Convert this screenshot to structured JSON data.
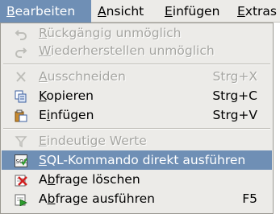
{
  "menubar": {
    "items": [
      {
        "label": "Bearbeiten",
        "mnemonic_index": 0
      },
      {
        "label": "Ansicht",
        "mnemonic_index": 0
      },
      {
        "label": "Einfügen",
        "mnemonic_index": 0
      },
      {
        "label": "Extras",
        "mnemonic_index": 0
      }
    ]
  },
  "menu": {
    "items": [
      {
        "label": "Rückgängig unmöglich",
        "shortcut": "",
        "enabled": false,
        "icon": "undo-icon"
      },
      {
        "label": "Wiederherstellen unmöglich",
        "shortcut": "",
        "enabled": false,
        "icon": "redo-icon"
      },
      {
        "label": "Ausschneiden",
        "shortcut": "Strg+X",
        "enabled": false,
        "icon": "cut-icon"
      },
      {
        "label": "Kopieren",
        "shortcut": "Strg+C",
        "enabled": true,
        "icon": "copy-icon"
      },
      {
        "label": "Einfügen",
        "shortcut": "Strg+V",
        "enabled": true,
        "icon": "paste-icon"
      },
      {
        "label": "Eindeutige Werte",
        "shortcut": "",
        "enabled": false,
        "icon": "distinct-values-icon"
      },
      {
        "label": "SQL-Kommando direkt ausführen",
        "shortcut": "",
        "enabled": true,
        "selected": true,
        "icon": "sql-icon"
      },
      {
        "label": "Abfrage löschen",
        "shortcut": "",
        "enabled": true,
        "icon": "clear-query-icon"
      },
      {
        "label": "Abfrage ausführen",
        "shortcut": "F5",
        "enabled": true,
        "icon": "run-query-icon"
      }
    ]
  },
  "colors": {
    "highlight": "#6f8fb5",
    "menu_bg": "#ecebe8",
    "disabled_text": "#a6a6a2"
  }
}
